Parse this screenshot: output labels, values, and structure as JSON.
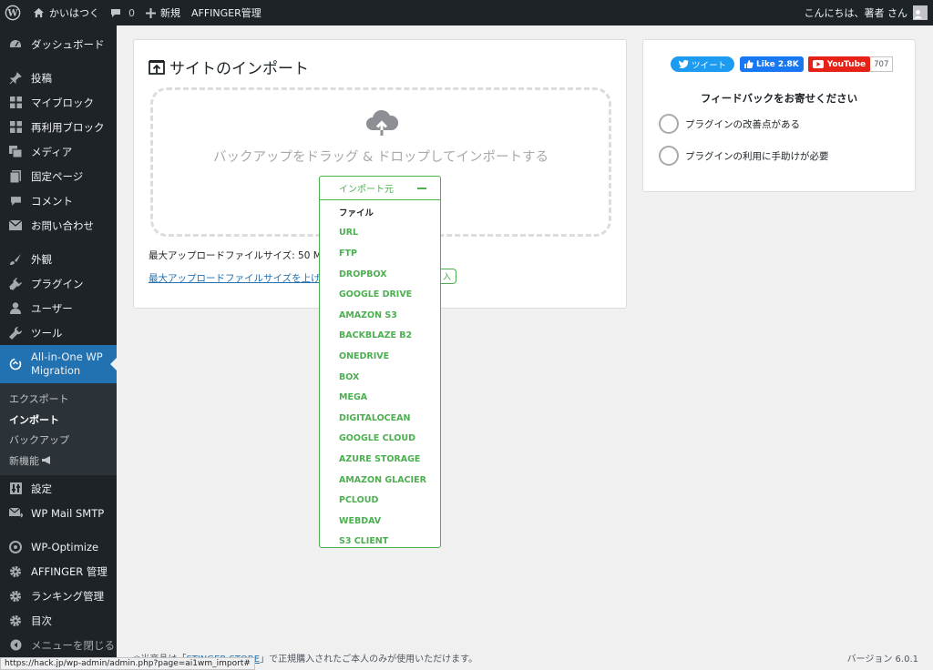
{
  "adminbar": {
    "site_name": "かいはつく",
    "comment_count": "0",
    "new_label": "新規",
    "affinger_label": "AFFINGER管理",
    "greeting": "こんにちは、著者 さん"
  },
  "sidebar": {
    "items": [
      {
        "label": "ダッシュボード",
        "icon": "dashboard-icon"
      },
      {
        "label": "投稿",
        "icon": "pin-icon"
      },
      {
        "label": "マイブロック",
        "icon": "block-icon"
      },
      {
        "label": "再利用ブロック",
        "icon": "block-icon"
      },
      {
        "label": "メディア",
        "icon": "media-icon"
      },
      {
        "label": "固定ページ",
        "icon": "page-icon"
      },
      {
        "label": "コメント",
        "icon": "comment-icon"
      },
      {
        "label": "お問い合わせ",
        "icon": "mail-icon"
      },
      {
        "label": "外観",
        "icon": "brush-icon"
      },
      {
        "label": "プラグイン",
        "icon": "plugin-icon"
      },
      {
        "label": "ユーザー",
        "icon": "user-icon"
      },
      {
        "label": "ツール",
        "icon": "wrench-icon"
      },
      {
        "label": "All-in-One WP Migration",
        "icon": "migration-icon"
      },
      {
        "label": "設定",
        "icon": "settings-icon"
      },
      {
        "label": "WP Mail SMTP",
        "icon": "mail-smtp-icon"
      },
      {
        "label": "WP-Optimize",
        "icon": "optimize-icon"
      },
      {
        "label": "AFFINGER 管理",
        "icon": "gear-icon"
      },
      {
        "label": "ランキング管理",
        "icon": "gear-icon"
      },
      {
        "label": "目次",
        "icon": "gear-icon"
      },
      {
        "label": "メニューを閉じる",
        "icon": "collapse-icon"
      }
    ],
    "submenu": [
      {
        "label": "エクスポート"
      },
      {
        "label": "インポート"
      },
      {
        "label": "バックアップ"
      },
      {
        "label": "新機能"
      }
    ]
  },
  "import": {
    "title": "サイトのインポート",
    "drop_text": "バックアップをドラッグ & ドロップしてインポートする",
    "max_size": "最大アップロードファイルサイズ: 50 MB",
    "increase_link": "最大アップロードファイルサイズを上げる",
    "buy_badge": "入"
  },
  "dropdown": {
    "header": "インポート元",
    "items": [
      "ファイル",
      "URL",
      "FTP",
      "DROPBOX",
      "GOOGLE DRIVE",
      "AMAZON S3",
      "BACKBLAZE B2",
      "ONEDRIVE",
      "BOX",
      "MEGA",
      "DIGITALOCEAN",
      "GOOGLE CLOUD",
      "AZURE STORAGE",
      "AMAZON GLACIER",
      "PCLOUD",
      "WEBDAV",
      "S3 CLIENT"
    ]
  },
  "feedback": {
    "tweet": "ツイート",
    "like": "Like 2.8K",
    "youtube": "YouTube",
    "youtube_count": "707",
    "title": "フィードバックをお寄せください",
    "options": [
      "プラグインの改善点がある",
      "プラグインの利用に手助けが必要"
    ]
  },
  "footer": {
    "prefix": "※当商品は「",
    "link": "STINGER STORE",
    "suffix": "」で正規購入されたご本人のみが使用いただけます。",
    "version": "バージョン 6.0.1"
  },
  "status_url": "https://hack.jp/wp-admin/admin.php?page=ai1wm_import#",
  "colors": {
    "adminbar_bg": "#1d2327",
    "accent": "#2271b1",
    "green": "#4caf50"
  }
}
